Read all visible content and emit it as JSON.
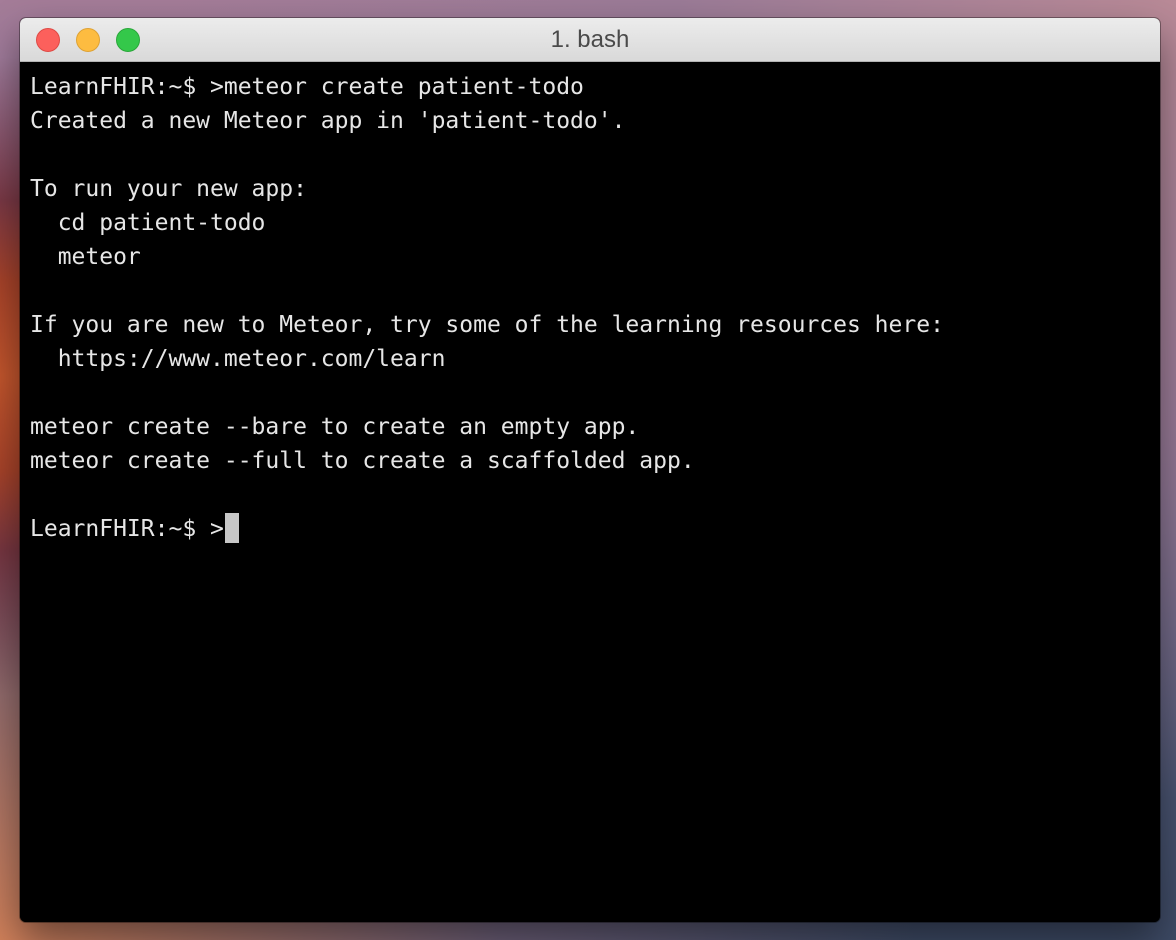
{
  "window": {
    "title": "1. bash",
    "controls": {
      "close_color": "#fc605c",
      "minimize_color": "#fdbc40",
      "zoom_color": "#34c84a"
    }
  },
  "terminal": {
    "lines": [
      "LearnFHIR:~$ >meteor create patient-todo",
      "Created a new Meteor app in 'patient-todo'.",
      "",
      "To run your new app:",
      "  cd patient-todo",
      "  meteor",
      "",
      "If you are new to Meteor, try some of the learning resources here:",
      "  https://www.meteor.com/learn",
      "",
      "meteor create --bare to create an empty app.",
      "meteor create --full to create a scaffolded app.",
      ""
    ],
    "prompt": "LearnFHIR:~$ >"
  }
}
